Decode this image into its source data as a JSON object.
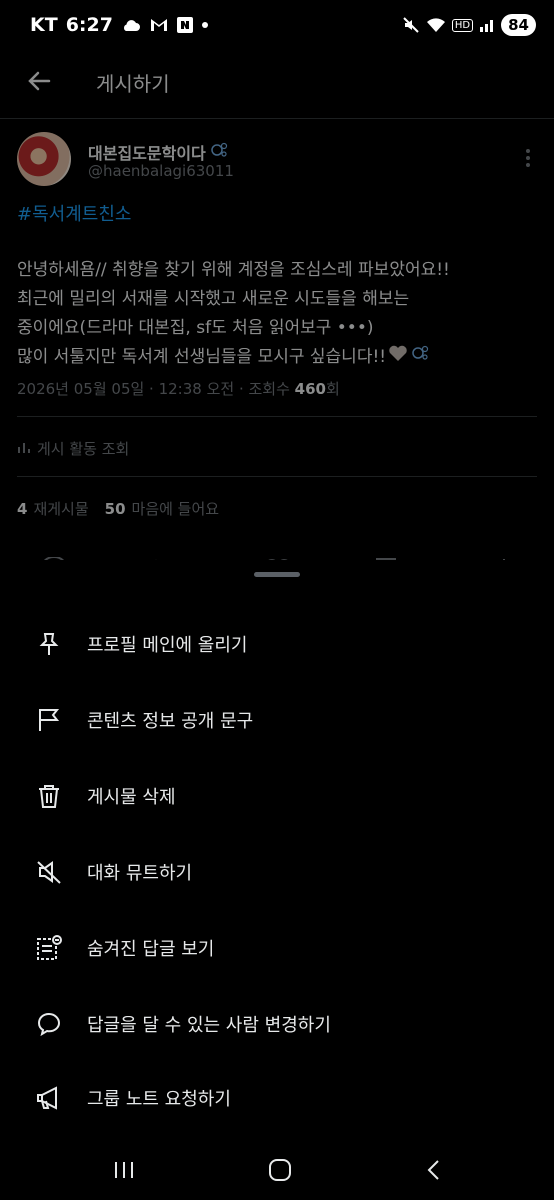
{
  "status_bar": {
    "carrier": "KT",
    "time": "6:27",
    "battery": "84",
    "network_badge": "HD"
  },
  "header": {
    "title": "게시하기"
  },
  "post": {
    "display_name": "대본집도문학이다",
    "handle": "@haenbalagi63011",
    "hashtag": "#독서계트친소",
    "lines": [
      "안녕하세욤// 취향을 찾기 위해 계정을 조심스레 파보았어요!!",
      "최근에 밀리의 서재를 시작했고 새로운 시도들을 해보는",
      "중이에요(드라마 대본집, sf도 처음 읽어보구 •••)",
      "많이 서툴지만 독서계 선생님들을 모시구 싶습니다!!"
    ],
    "timestamp": "2026년 05월 05일 · 12:38 오전 · 조회수 ",
    "views": "460",
    "views_suffix": "회",
    "activity_label": "게시 활동 조회",
    "reposts_count": "4",
    "reposts_label": "재게시물",
    "likes_count": "50",
    "likes_label": "마음에 들어요"
  },
  "menu": {
    "items": [
      {
        "icon": "pin-icon",
        "label": "프로필 메인에 올리기"
      },
      {
        "icon": "flag-icon",
        "label": "콘텐츠 정보 공개 문구"
      },
      {
        "icon": "trash-icon",
        "label": "게시물 삭제"
      },
      {
        "icon": "mute-icon",
        "label": "대화 뮤트하기"
      },
      {
        "icon": "hidden-replies-icon",
        "label": "숨겨진 답글 보기"
      },
      {
        "icon": "speech-bubble-icon",
        "label": "답글을 달 수 있는 사람 변경하기"
      },
      {
        "icon": "megaphone-icon",
        "label": "그룹 노트 요청하기"
      }
    ]
  },
  "colors": {
    "background": "#000000",
    "accent": "#1d9bf0",
    "secondary_text": "#71767b"
  }
}
